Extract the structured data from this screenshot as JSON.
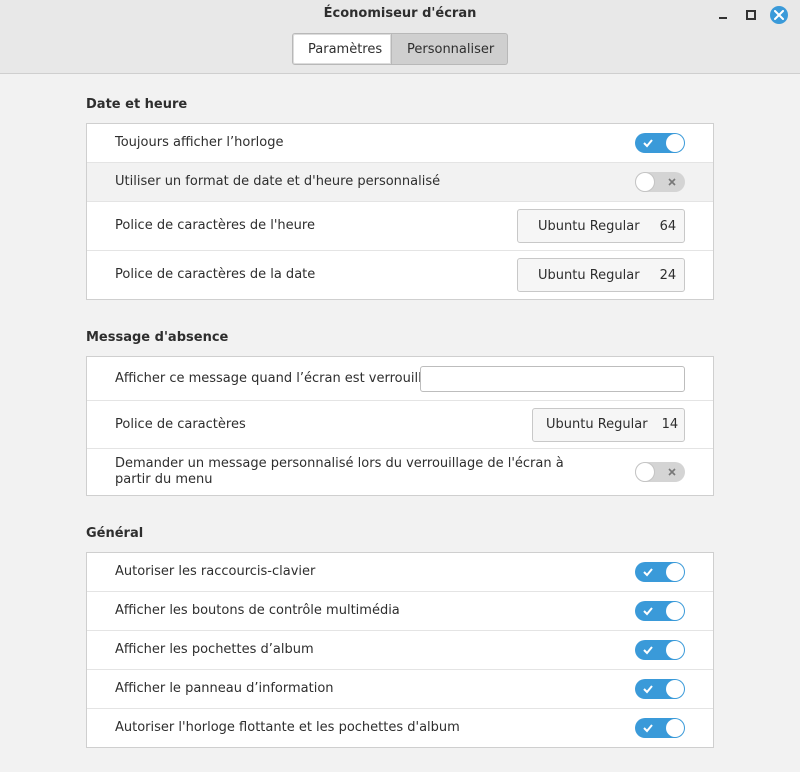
{
  "window": {
    "title": "Économiseur d'écran"
  },
  "tabs": [
    {
      "label": "Paramètres",
      "active": true
    },
    {
      "label": "Personnaliser",
      "active": false
    }
  ],
  "colors": {
    "accent": "#3a9ad9",
    "toggle_off": "#d4d4d4"
  },
  "date_time": {
    "title": "Date et heure",
    "always_show_clock": {
      "label": "Toujours afficher l’horloge",
      "on": true
    },
    "custom_format": {
      "label": "Utiliser un format de date et d'heure personnalisé",
      "on": false
    },
    "time_font": {
      "label": "Police de caractères de l'heure",
      "font": "Ubuntu Regular",
      "size": "64"
    },
    "date_font": {
      "label": "Police de caractères de la date",
      "font": "Ubuntu Regular",
      "size": "24"
    }
  },
  "away_message": {
    "title": "Message d'absence",
    "show_message": {
      "label": "Afficher ce message quand l’écran est verrouillé",
      "value": ""
    },
    "font": {
      "label": "Police de caractères",
      "font": "Ubuntu Regular",
      "size": "14"
    },
    "ask_custom": {
      "label": "Demander un message personnalisé lors du verrouillage de l'écran à partir du menu",
      "on": false
    }
  },
  "general": {
    "title": "Général",
    "items": [
      {
        "label": "Autoriser les raccourcis-clavier",
        "on": true
      },
      {
        "label": "Afficher les boutons de contrôle multimédia",
        "on": true
      },
      {
        "label": "Afficher les pochettes d’album",
        "on": true
      },
      {
        "label": "Afficher le panneau d’information",
        "on": true
      },
      {
        "label": "Autoriser l'horloge flottante et les pochettes d'album",
        "on": true
      }
    ]
  }
}
